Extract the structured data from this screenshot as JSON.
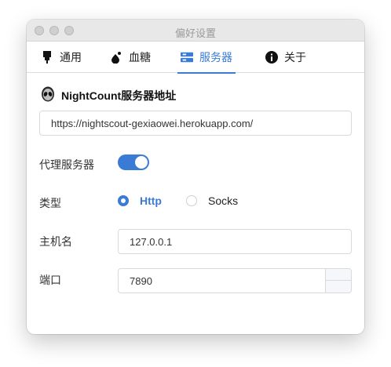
{
  "window": {
    "title": "偏好设置"
  },
  "tabs": [
    {
      "label": "通用",
      "icon": "plug-icon"
    },
    {
      "label": "血糖",
      "icon": "drop-icon"
    },
    {
      "label": "服务器",
      "icon": "server-icon",
      "active": true
    },
    {
      "label": "关于",
      "icon": "info-icon"
    }
  ],
  "server": {
    "section_title": "NightCount服务器地址",
    "url": "https://nightscout-gexiaowei.herokuapp.com/",
    "proxy_label": "代理服务器",
    "proxy_enabled": true,
    "type_label": "类型",
    "type_options": [
      "Http",
      "Socks"
    ],
    "type_selected": "Http",
    "host_label": "主机名",
    "host": "127.0.0.1",
    "port_label": "端口",
    "port": "7890"
  },
  "colors": {
    "accent": "#3a7bd5"
  }
}
